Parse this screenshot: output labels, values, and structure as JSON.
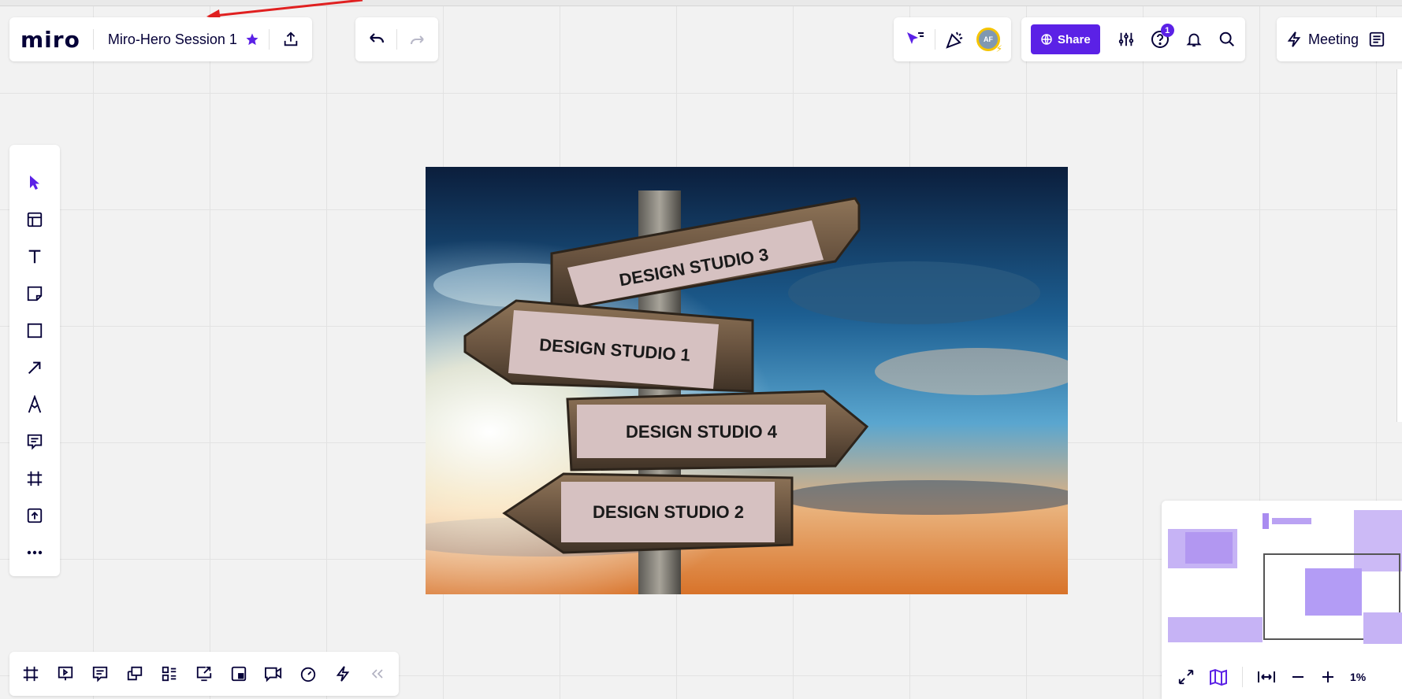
{
  "app": {
    "logo": "miro",
    "board_title": "Miro-Hero Session 1"
  },
  "collab": {
    "avatar_initials": "AF"
  },
  "share": {
    "label": "Share",
    "notification_count": "1"
  },
  "meeting": {
    "label": "Meeting"
  },
  "left_toolbar": {
    "tools": [
      "select",
      "templates",
      "text",
      "sticky-note",
      "shape",
      "connection-line",
      "pen",
      "comment",
      "frame",
      "upload",
      "more"
    ]
  },
  "board_image": {
    "signs": [
      "DESIGN STUDIO 3",
      "DESIGN STUDIO 1",
      "DESIGN STUDIO 4",
      "DESIGN STUDIO 2"
    ]
  },
  "minimap": {
    "zoom_level": "1%"
  },
  "bottom_toolbar": {
    "tools": [
      "frames",
      "presentation",
      "notes",
      "cards",
      "kanban",
      "export",
      "screen-share",
      "video-call",
      "timer",
      "activity",
      "collapse"
    ]
  },
  "colors": {
    "accent": "#5b21e6",
    "ink": "#050038",
    "annotation": "#e02020"
  }
}
